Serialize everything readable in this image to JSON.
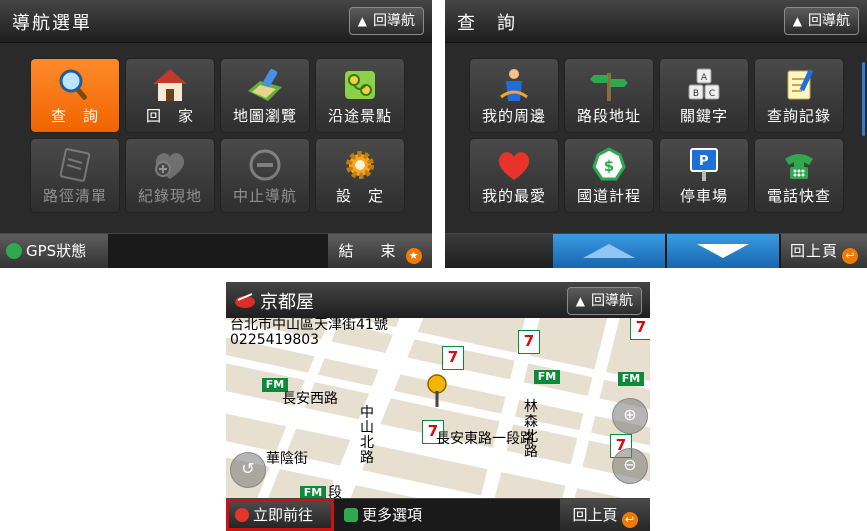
{
  "panel1": {
    "title": "導航選單",
    "back_nav": "回導航",
    "items": [
      {
        "label": "查　詢"
      },
      {
        "label": "回　家"
      },
      {
        "label": "地圖瀏覽"
      },
      {
        "label": "沿途景點"
      },
      {
        "label": "路徑清單"
      },
      {
        "label": "紀錄現地"
      },
      {
        "label": "中止導航"
      },
      {
        "label": "設　定"
      }
    ],
    "gps_label": "GPS狀態",
    "end_label": "結　束"
  },
  "panel2": {
    "title": "查　詢",
    "back_nav": "回導航",
    "items": [
      {
        "label": "我的周邊"
      },
      {
        "label": "路段地址"
      },
      {
        "label": "關鍵字"
      },
      {
        "label": "查詢記錄"
      },
      {
        "label": "我的最愛"
      },
      {
        "label": "國道計程"
      },
      {
        "label": "停車場"
      },
      {
        "label": "電話快查"
      }
    ],
    "back_page": "回上頁"
  },
  "panel3": {
    "title": "京都屋",
    "back_nav": "回導航",
    "address": "台北市中山區天津街41號",
    "phone": "0225419803",
    "go_now": "立即前往",
    "more_options": "更多選項",
    "back_page": "回上頁",
    "map_labels": {
      "changan_west": "長安西路",
      "changan_east": "長安東路一段路",
      "zhongshan_north": "中山北路",
      "linsen_north": "林森北路",
      "huayin": "華陰街",
      "duan": "段"
    },
    "store_labels": {
      "fm": "FM",
      "seven": "7"
    }
  },
  "colors": {
    "accent_orange": "#f06400",
    "selected_red": "#d01010",
    "nav_blue": "#1766b0",
    "green_gps": "#2fa84f"
  }
}
